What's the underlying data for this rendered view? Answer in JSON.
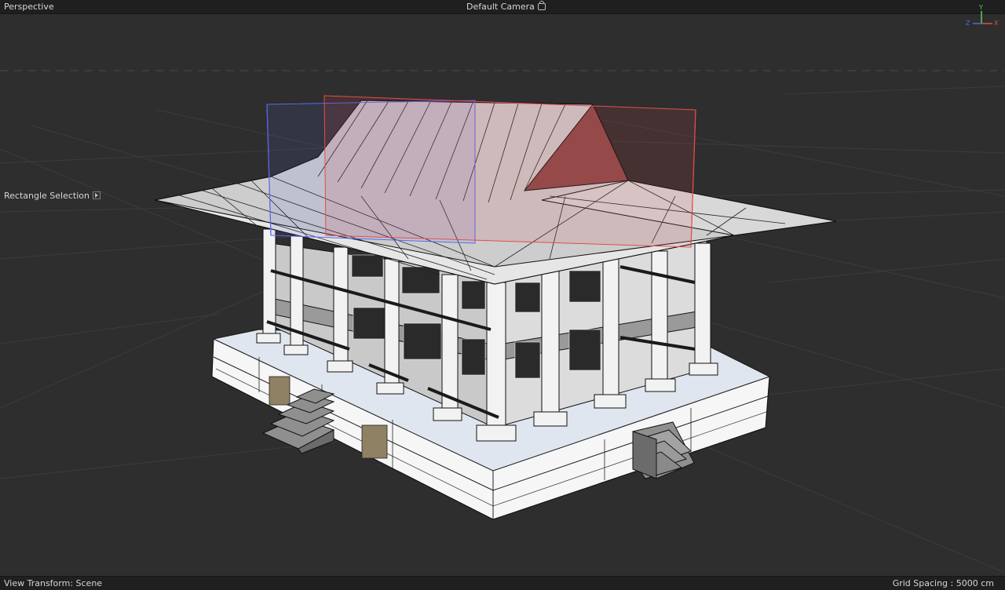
{
  "viewport": {
    "name": "Perspective",
    "camera": "Default Camera",
    "camera_icon": "lock-icon",
    "hud_label": "Rectangle Selection",
    "hud_icon": "expand-arrow-icon",
    "view_transform": "View Transform: Scene",
    "grid_spacing": "Grid Spacing : 5000 cm",
    "axes": {
      "y": "Y",
      "z": "Z",
      "x": "X"
    }
  },
  "colors": {
    "background": "#2e2e2e",
    "grid": "#3a3a3a",
    "axis_x": "#e34d4d",
    "axis_y": "#5bd05b",
    "axis_z": "#4b69e7",
    "roof": "#cfcfcf",
    "wall": "#e2e2e2",
    "base": "#eef2f7"
  }
}
